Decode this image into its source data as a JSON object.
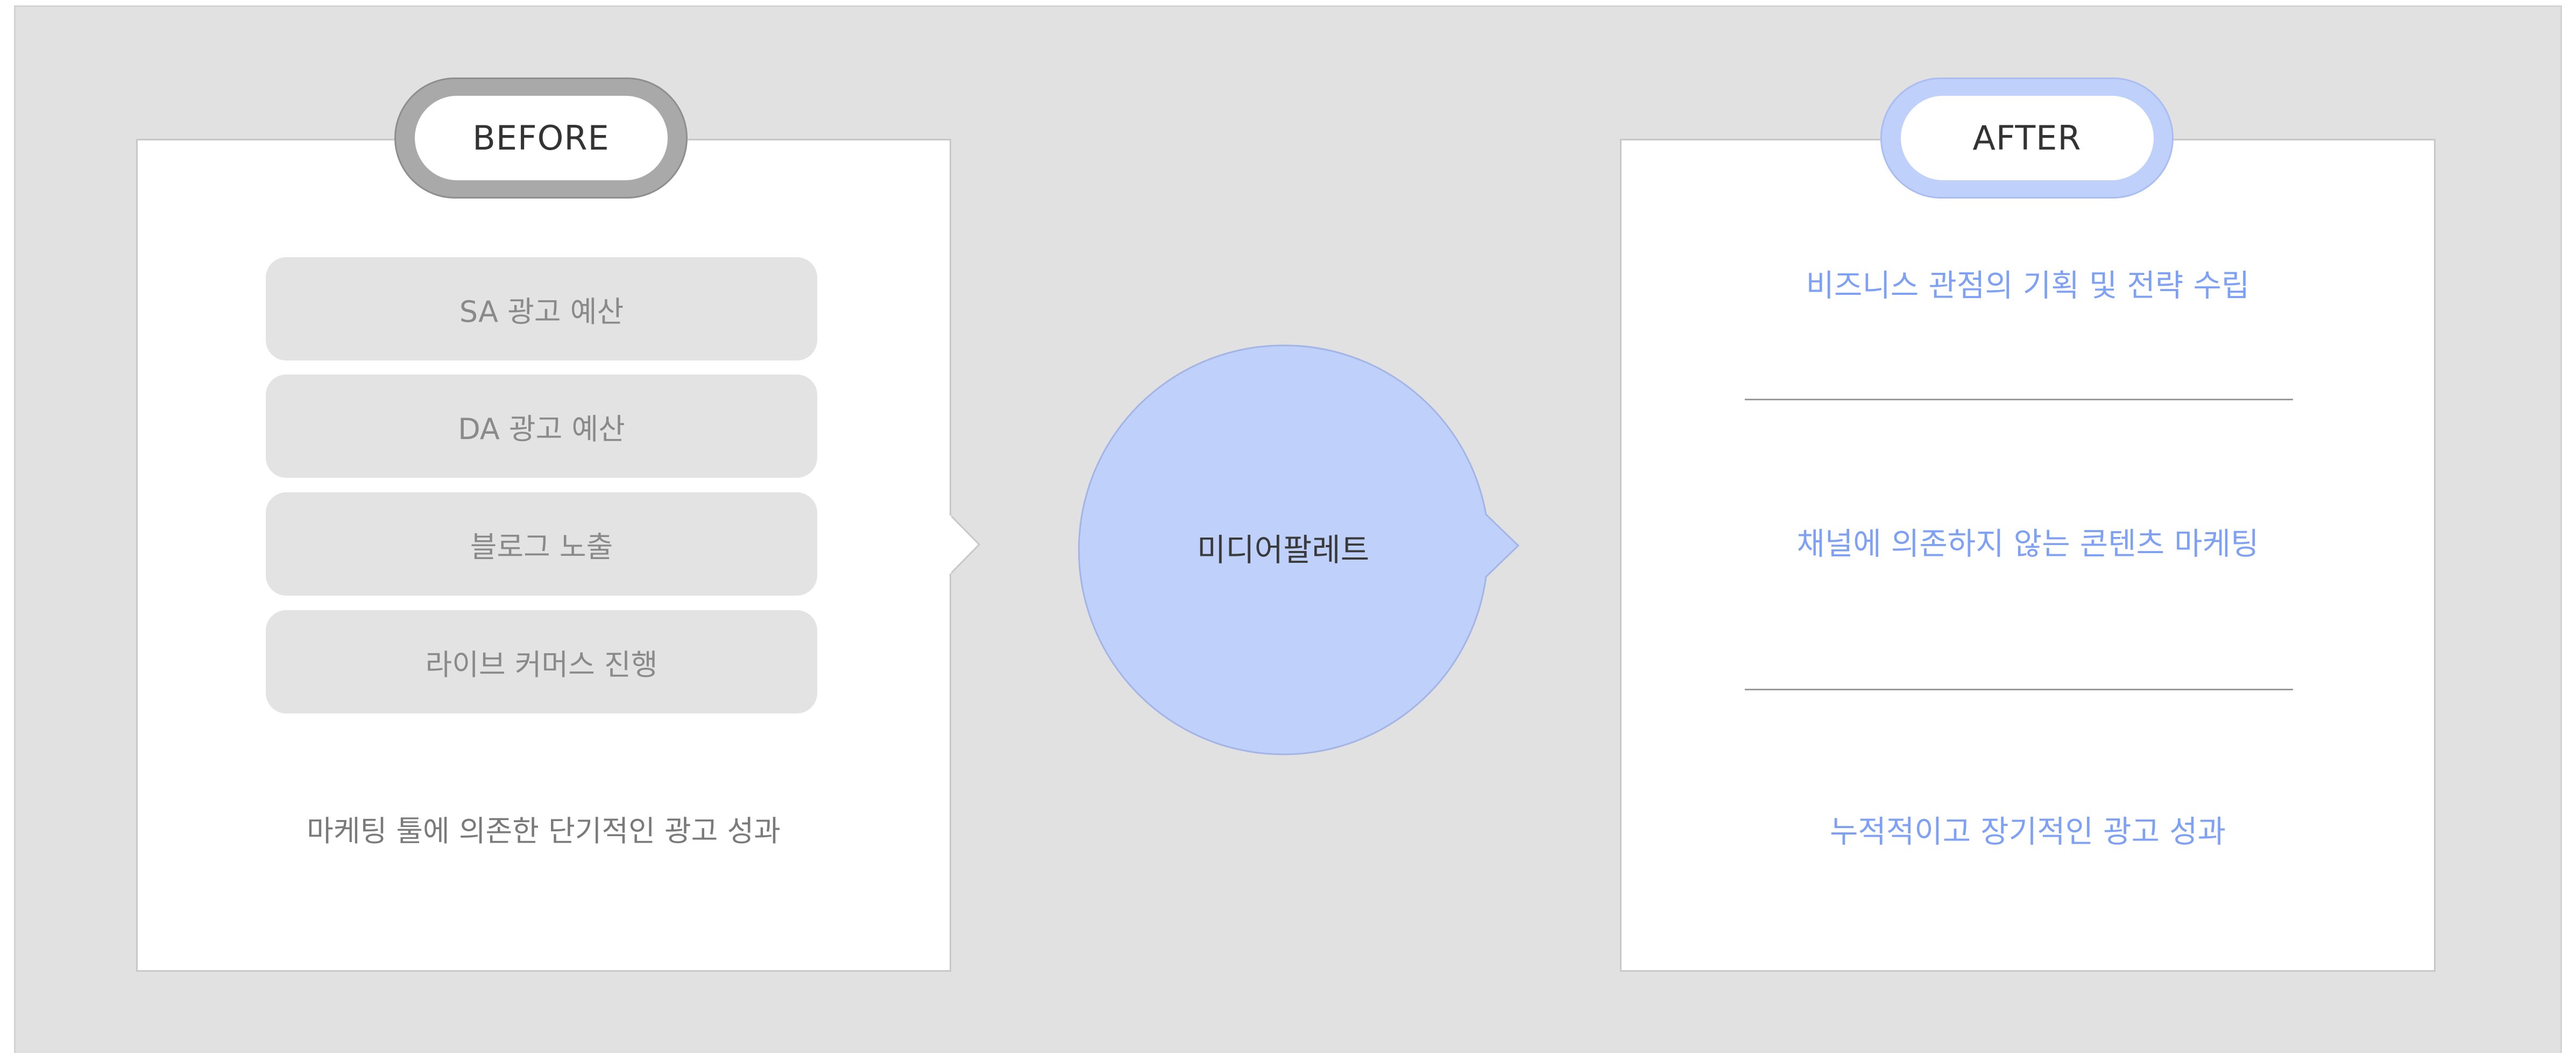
{
  "before": {
    "badge_label": "BEFORE",
    "items": [
      {
        "label": "SA 광고 예산"
      },
      {
        "label": "DA 광고 예산"
      },
      {
        "label": "블로그 노출"
      },
      {
        "label": "라이브 커머스 진행"
      }
    ],
    "summary": "마케팅 툴에 의존한 단기적인 광고 성과"
  },
  "center": {
    "label": "미디어팔레트"
  },
  "after": {
    "badge_label": "AFTER",
    "items": [
      {
        "label": "비즈니스 관점의 기획 및 전략 수립"
      },
      {
        "label": "채널에 의존하지 않는 콘텐츠 마케팅"
      },
      {
        "label": "누적적이고 장기적인 광고 성과"
      }
    ]
  },
  "colors": {
    "background": "#e1e1e1",
    "panel": "#ffffff",
    "before_badge": "#a9a9a9",
    "after_badge": "#bfd0fb",
    "circle": "#bfd0fb",
    "after_text": "#7ea0f5",
    "item_fill": "#e3e3e3"
  }
}
